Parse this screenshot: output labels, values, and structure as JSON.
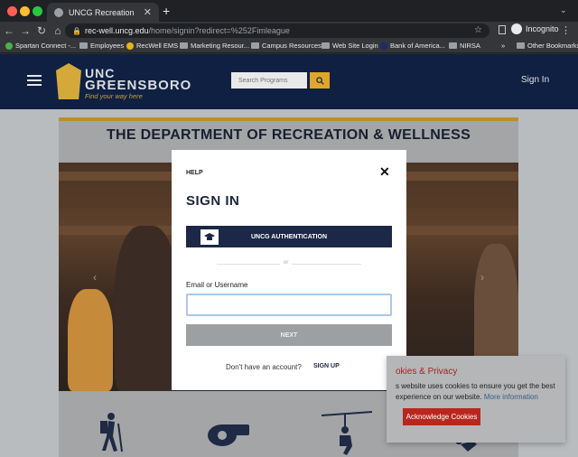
{
  "browser": {
    "tab_title": "UNCG Recreation",
    "url_host": "rec-well.uncg.edu",
    "url_path": "/home/signin?redirect=%252Fimleague",
    "profile_label": "Incognito",
    "bookmarks": [
      {
        "label": "Spartan Connect -...",
        "icon": "green"
      },
      {
        "label": "Employees",
        "icon": "folder"
      },
      {
        "label": "RecWell EMS",
        "icon": "yellow"
      },
      {
        "label": "Marketing Resour...",
        "icon": "folder"
      },
      {
        "label": "Campus Resources",
        "icon": "folder"
      },
      {
        "label": "Web Site Login",
        "icon": "folder"
      },
      {
        "label": "Bank of America...",
        "icon": "navy"
      },
      {
        "label": "NIRSA",
        "icon": "folder"
      }
    ],
    "bookmarks_overflow": "»",
    "other_bookmarks": "Other Bookmarks"
  },
  "site": {
    "logo_line1": "UNC",
    "logo_line2": "GREENSBORO",
    "logo_tagline": "Find your way here",
    "search_placeholder": "Search Programs",
    "sign_in": "Sign In",
    "department_title": "THE DEPARTMENT OF RECREATION & WELLNESS"
  },
  "modal": {
    "help": "HELP",
    "title": "SIGN IN",
    "auth_button": "UNCG AUTHENTICATION",
    "divider": "or",
    "email_label": "Email or Username",
    "email_value": "",
    "next_button": "NEXT",
    "no_account": "Don't have an account?",
    "sign_up": "SIGN UP"
  },
  "cookies": {
    "title": "okies & Privacy",
    "body_part1": "s website uses cookies to ensure you get the best experience on our website.",
    "more_info": "More information",
    "button": "Acknowledge Cookies"
  },
  "colors": {
    "navy": "#1c2847",
    "gold": "#e0a62b",
    "cookie_red": "#b8271f"
  }
}
